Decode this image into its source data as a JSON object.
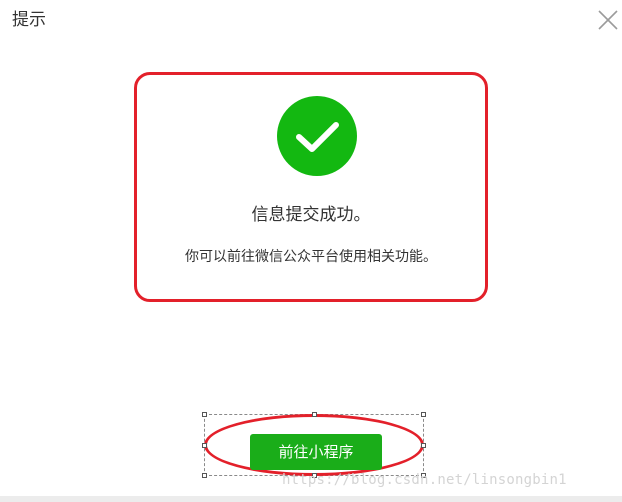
{
  "dialog": {
    "title": "提示"
  },
  "success": {
    "title": "信息提交成功。",
    "description": "你可以前往微信公众平台使用相关功能。",
    "icon": "check-circle-icon",
    "icon_color": "#13b811"
  },
  "actions": {
    "go_button_label": "前往小程序",
    "button_color": "#1aad19"
  },
  "annotations": {
    "outline_color": "#e3202a"
  },
  "watermark": {
    "text": "https://blog.csdn.net/linsongbin1"
  }
}
